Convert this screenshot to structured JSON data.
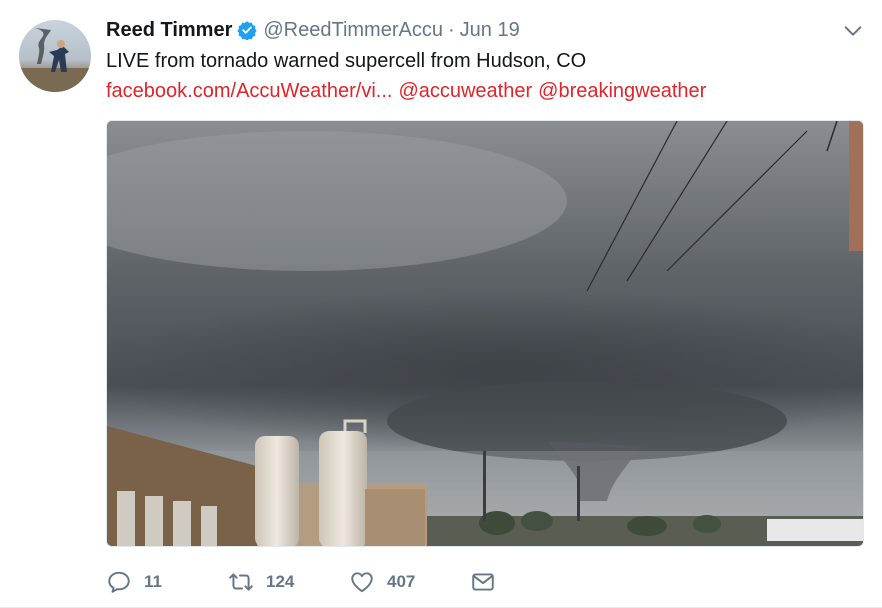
{
  "tweet": {
    "author_name": "Reed Timmer",
    "handle": "@ReedTimmerAccu",
    "separator": "·",
    "date": "Jun 19",
    "text": "LIVE from tornado warned supercell from Hudson, CO",
    "link_url": "facebook.com/AccuWeather/vi...",
    "mention_1": "@accuweather",
    "mention_2": "@breakingweather",
    "media_description": "Photo of a dark supercell storm with a lowering wall cloud over industrial silos and power lines"
  },
  "actions": {
    "replies": "11",
    "retweets": "124",
    "likes": "407"
  },
  "icons": {
    "verified": "verified-badge-icon",
    "caret": "chevron-down-icon",
    "reply": "reply-icon",
    "retweet": "retweet-icon",
    "like": "heart-icon",
    "message": "envelope-icon"
  },
  "colors": {
    "link": "#e0242a",
    "verified": "#1da1f2",
    "meta": "#657786",
    "text": "#14171a"
  }
}
